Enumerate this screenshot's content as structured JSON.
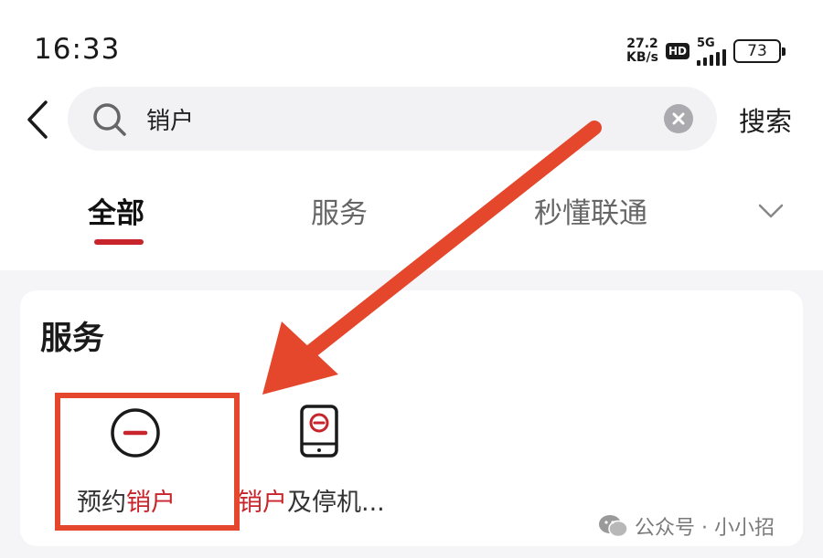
{
  "status_bar": {
    "time": "16:33",
    "net_speed_value": "27.2",
    "net_speed_unit": "KB/s",
    "hd_badge": "HD",
    "signal_type": "5G",
    "battery_level": "73"
  },
  "search": {
    "query": "销户",
    "submit_label": "搜索"
  },
  "tabs": [
    {
      "label": "全部",
      "active": true
    },
    {
      "label": "服务",
      "active": false
    },
    {
      "label": "秒懂联通",
      "active": false
    }
  ],
  "service_section": {
    "title": "服务",
    "items": [
      {
        "label_prefix": "预约",
        "label_highlight": "销户",
        "label_suffix": "",
        "icon": "minus-circle-icon"
      },
      {
        "label_prefix": "",
        "label_highlight": "销户",
        "label_suffix": "及停机...",
        "icon": "phone-minus-icon"
      }
    ]
  },
  "watermark": {
    "text": "公众号 · 小小招",
    "icon": "wechat-icon"
  },
  "colors": {
    "accent_red": "#c8242b",
    "annotation_orange": "#e4472c"
  }
}
